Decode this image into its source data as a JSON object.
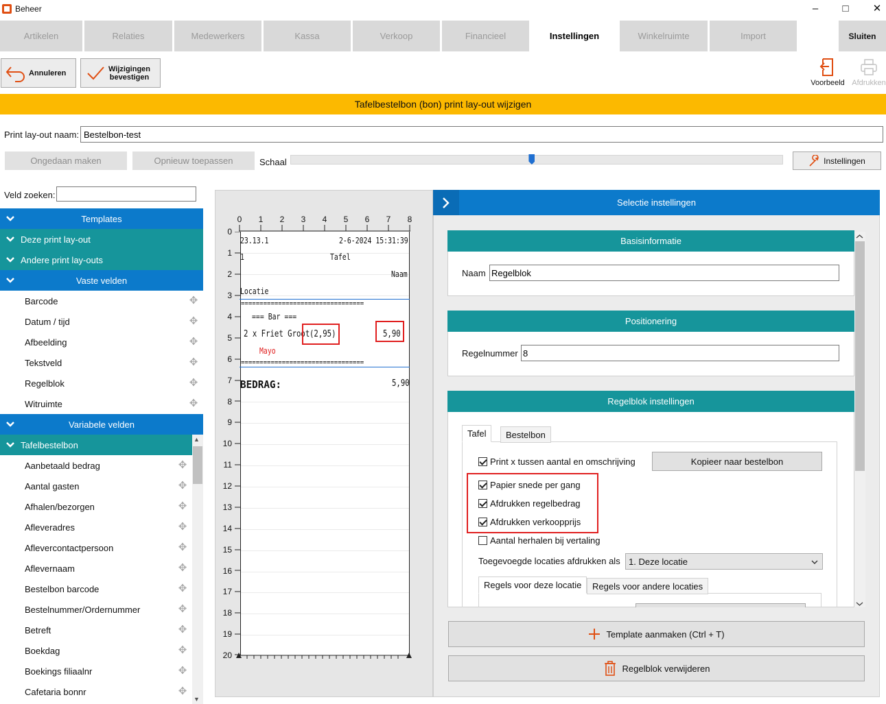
{
  "window": {
    "title": "Beheer"
  },
  "tabs": [
    "Artikelen",
    "Relaties",
    "Medewerkers",
    "Kassa",
    "Verkoop",
    "Financieel",
    "Instellingen",
    "Winkelruimte",
    "Import"
  ],
  "close_label": "Sluiten",
  "toolbar": {
    "cancel": "Annuleren",
    "confirm_line1": "Wijzigingen",
    "confirm_line2": "bevestigen",
    "preview": "Voorbeeld",
    "print": "Afdrukken"
  },
  "banner": "Tafelbestelbon (bon) print lay-out wijzigen",
  "layout_name_label": "Print lay-out naam:",
  "layout_name_value": "Bestelbon-test",
  "undo": "Ongedaan maken",
  "redo": "Opnieuw toepassen",
  "scale_label": "Schaal",
  "scale_value_percent": 49,
  "settings_label": "Instellingen",
  "search_label": "Veld zoeken:",
  "sections": {
    "templates": "Templates",
    "this_layout": "Deze print lay-out",
    "other_layouts": "Andere print lay-outs",
    "fixed": "Vaste velden",
    "variable": "Variabele velden",
    "tafelbestelbon": "Tafelbestelbon"
  },
  "fixed_fields": [
    "Barcode",
    "Datum / tijd",
    "Afbeelding",
    "Tekstveld",
    "Regelblok",
    "Witruimte"
  ],
  "variable_fields": [
    "Aanbetaald bedrag",
    "Aantal gasten",
    "Afhalen/bezorgen",
    "Afleveradres",
    "Aflevercontactpersoon",
    "Aflevernaam",
    "Bestelbon barcode",
    "Bestelnummer/Ordernummer",
    "Betreft",
    "Boekdag",
    "Boekings filiaalnr",
    "Cafetaria bonnr"
  ],
  "ruler_cols": [
    "0",
    "1",
    "2",
    "3",
    "4",
    "5",
    "6",
    "7",
    "8"
  ],
  "ruler_rows": [
    "0",
    "1",
    "2",
    "3",
    "4",
    "5",
    "6",
    "7",
    "8",
    "9",
    "10",
    "11",
    "12",
    "13",
    "14",
    "15",
    "16",
    "17",
    "18",
    "19",
    "20"
  ],
  "receipt": {
    "r0_left": "23.13.1",
    "r0_right": "2-6-2024 15:31:39",
    "r1_left": "1",
    "r1_center": "Tafel",
    "r2_right": "Naam",
    "r3_left": "Locatie",
    "sep": "=================================",
    "bar": "=== Bar ===",
    "line_item": "2 x Friet Groot",
    "unit_price": "(2,95)",
    "line_total": "5,90",
    "modifier": "Mayo",
    "total_label": "BEDRAG:",
    "total_value": "5,90"
  },
  "right": {
    "header": "Selectie instellingen",
    "basic_header": "Basisinformatie",
    "name_label": "Naam",
    "name_value": "Regelblok",
    "pos_header": "Positionering",
    "line_label": "Regelnummer",
    "line_value": "8",
    "rb_header": "Regelblok instellingen",
    "subtab_table": "Tafel",
    "subtab_order": "Bestelbon",
    "cb_print_x": "Print x tussen aantal en omschrijving",
    "copy_btn": "Kopieer naar bestelbon",
    "cb_cut": "Papier snede per gang",
    "cb_line_amount": "Afdrukken regelbedrag",
    "cb_sale_price": "Afdrukken verkoopprijs",
    "cb_repeat": "Aantal herhalen bij vertaling",
    "loc_label": "Toegevoegde locaties afdrukken als",
    "loc_value": "1. Deze locatie",
    "tab_this_loc": "Regels voor deze locatie",
    "tab_other_loc": "Regels voor andere locaties",
    "create_template": "Template aanmaken (Ctrl + T)",
    "delete_block": "Regelblok verwijderen"
  }
}
